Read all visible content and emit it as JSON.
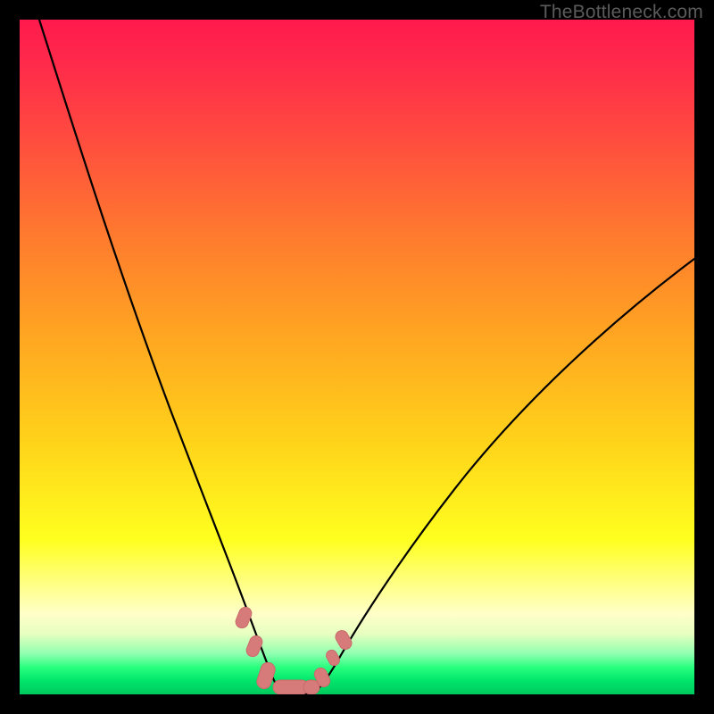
{
  "watermark": "TheBottleneck.com",
  "chart_data": {
    "type": "line",
    "title": "",
    "xlabel": "",
    "ylabel": "",
    "xlim": [
      0,
      100
    ],
    "ylim": [
      0,
      100
    ],
    "background_gradient": {
      "orientation": "vertical",
      "stops": [
        {
          "pos": 0,
          "color": "#ff1a4d"
        },
        {
          "pos": 18,
          "color": "#ff4d3f"
        },
        {
          "pos": 46,
          "color": "#ffa322"
        },
        {
          "pos": 77,
          "color": "#ffff1f"
        },
        {
          "pos": 94,
          "color": "#8fffb0"
        },
        {
          "pos": 100,
          "color": "#00c95d"
        }
      ]
    },
    "series": [
      {
        "name": "left-branch",
        "x": [
          3,
          6,
          10,
          14,
          18,
          22,
          26,
          29,
          31,
          33,
          34.5,
          35.5
        ],
        "y": [
          100,
          88,
          74,
          60,
          46,
          33,
          21,
          12,
          7,
          3,
          1,
          0
        ]
      },
      {
        "name": "right-branch",
        "x": [
          43,
          44,
          46,
          49,
          53,
          58,
          64,
          71,
          79,
          88,
          97,
          100
        ],
        "y": [
          0,
          1,
          3,
          6,
          10,
          15,
          21,
          27,
          33,
          39,
          45,
          47
        ]
      },
      {
        "name": "flat-bottom",
        "x": [
          35.5,
          43
        ],
        "y": [
          0,
          0
        ]
      }
    ],
    "markers": {
      "name": "highlight-points",
      "style": "pill",
      "color": "#d67a7a",
      "points": [
        {
          "x": 32.0,
          "y": 11.0,
          "len": 3
        },
        {
          "x": 33.5,
          "y": 6.0,
          "len": 3
        },
        {
          "x": 35.5,
          "y": 1.0,
          "len": 4
        },
        {
          "x": 38.0,
          "y": 0.0,
          "len": 5
        },
        {
          "x": 41.5,
          "y": 0.0,
          "len": 4
        },
        {
          "x": 44.0,
          "y": 2.0,
          "len": 3
        },
        {
          "x": 46.0,
          "y": 5.5,
          "len": 2
        },
        {
          "x": 47.5,
          "y": 8.5,
          "len": 3
        }
      ]
    }
  }
}
